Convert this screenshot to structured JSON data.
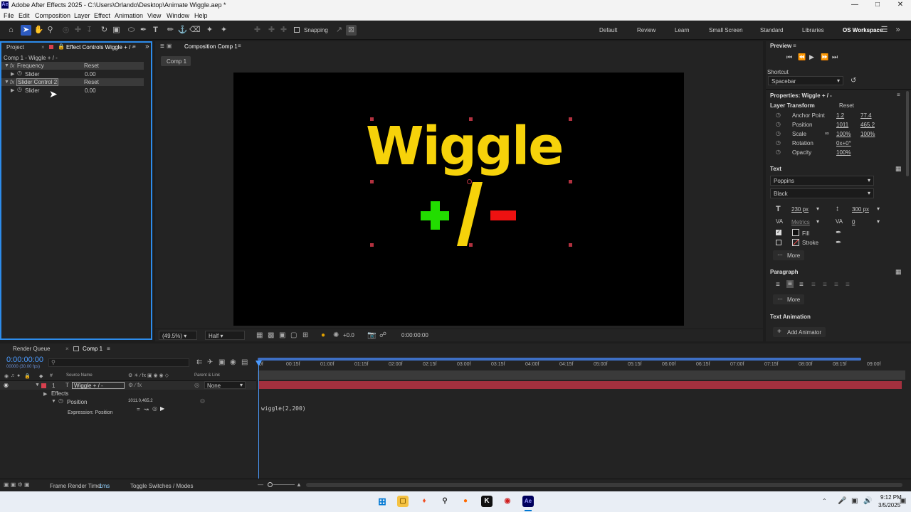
{
  "window": {
    "title": "Adobe After Effects 2025 - C:\\Users\\Orlando\\Desktop\\Animate Wiggle.aep *"
  },
  "menu": [
    "File",
    "Edit",
    "Composition",
    "Layer",
    "Effect",
    "Animation",
    "View",
    "Window",
    "Help"
  ],
  "toolbar": {
    "snapping_label": "Snapping"
  },
  "workspaces": [
    "Default",
    "Review",
    "Learn",
    "Small Screen",
    "Standard",
    "Libraries",
    "OS Workspace"
  ],
  "left_panel": {
    "tab_project": "Project",
    "tab_effect_controls": "Effect Controls Wiggle + / -",
    "header": "Comp 1 - Wiggle + / -",
    "effects": [
      {
        "name": "Frequency",
        "reset": "Reset",
        "param": "Slider",
        "value": "0.00"
      },
      {
        "name": "Slider Control 2",
        "reset": "Reset",
        "param": "Slider",
        "value": "0.00"
      }
    ]
  },
  "comp_panel": {
    "tab": "Composition Comp 1",
    "chip": "Comp 1",
    "zoom": "(49.5%)",
    "resolution": "Half",
    "exposure": "+0.0",
    "timecode": "0:00:00:00",
    "canvas": {
      "title": "Wiggle",
      "plus": "+",
      "slash": "/",
      "title_color": "#f6d20a",
      "plus_color": "#22dd00",
      "minus_color": "#ee1111"
    }
  },
  "right_panel": {
    "preview_title": "Preview",
    "shortcut_label": "Shortcut",
    "shortcut_value": "Spacebar",
    "properties_title": "Properties: Wiggle + / -",
    "layer_transform": "Layer Transform",
    "reset": "Reset",
    "props": [
      {
        "name": "Anchor Point",
        "v1": "1.2",
        "v2": "77.4"
      },
      {
        "name": "Position",
        "v1": "1011",
        "v2": "465.2"
      },
      {
        "name": "Scale",
        "v1": "100%",
        "v2": "100%"
      },
      {
        "name": "Rotation",
        "v1": "0x+0°",
        "v2": ""
      },
      {
        "name": "Opacity",
        "v1": "100%",
        "v2": ""
      }
    ],
    "text_section": "Text",
    "font": "Poppins",
    "font_style": "Black",
    "font_size": "230 px",
    "leading": "300 px",
    "kerning": "Metrics",
    "tracking": "0",
    "fill": "Fill",
    "stroke": "Stroke",
    "more": "More",
    "paragraph": "Paragraph",
    "text_animation": "Text Animation",
    "add_animator": "Add Animator"
  },
  "timeline": {
    "tab_render": "Render Queue",
    "tab_comp": "Comp 1",
    "timecode": "0:00:00:00",
    "fps": "00000 (30.00 fps)",
    "col_source": "Source Name",
    "col_parent": "Parent & Link",
    "layer_num": "1",
    "layer_name": "Wiggle + / -",
    "parent": "None",
    "effects_label": "Effects",
    "position_label": "Position",
    "position_value": "1011.0,465.2",
    "expression_label": "Expression: Position",
    "expression_code": "wiggle(2,200)",
    "ruler": [
      "0f",
      "00:15f",
      "01:00f",
      "01:15f",
      "02:00f",
      "02:15f",
      "03:00f",
      "03:15f",
      "04:00f",
      "04:15f",
      "05:00f",
      "05:15f",
      "06:00f",
      "06:15f",
      "07:00f",
      "07:15f",
      "08:00f",
      "08:15f",
      "09:00f"
    ],
    "frame_render_label": "Frame Render Time:",
    "frame_render_value": "1ms",
    "toggle_label": "Toggle Switches / Modes"
  },
  "taskbar": {
    "time": "9:12 PM",
    "date": "3/5/2025"
  }
}
